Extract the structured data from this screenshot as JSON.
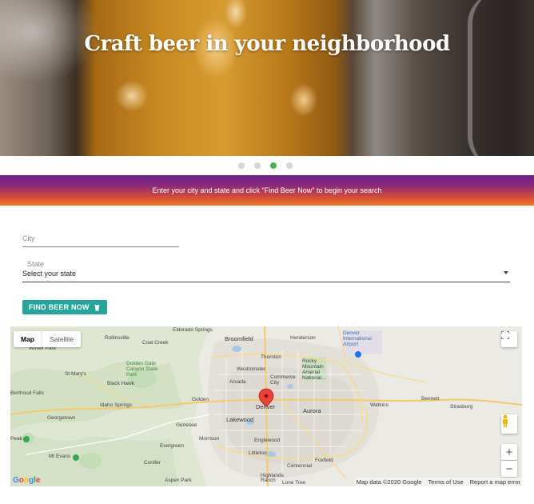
{
  "hero": {
    "title": "Craft beer in your neighborhood",
    "carousel_dots": 4,
    "active_dot": 3
  },
  "banner": {
    "text": "Enter your city and state and click \"Find Beer Now\" to begin your search"
  },
  "form": {
    "city_placeholder": "City",
    "state_label": "State",
    "state_value": "Select your state",
    "submit_label": "FIND BEER NOW"
  },
  "map": {
    "type_map": "Map",
    "type_satellite": "Satellite",
    "attribution": {
      "data": "Map data ©2020 Google",
      "terms": "Terms of Use",
      "report": "Report a map error"
    },
    "google_logo": "Google",
    "labels": {
      "eldorado": "Eldorado Springs",
      "henderson": "Henderson",
      "denver_airport": "Denver International Airport",
      "broomfield": "Broomfield",
      "rollinsville": "Rollinsville",
      "coal_creek": "Coal Creek",
      "winter_park": "Winter Park",
      "thornton": "Thornton",
      "golden_gate": "Golden Gate Canyon State Park",
      "westminster": "Westminster",
      "rocky_mountain": "Rocky Mountain Arsenal National...",
      "commerce_city": "Commerce City",
      "st_marys": "St Mary's",
      "black_hawk": "Black Hawk",
      "arvada": "Arvada",
      "berthoud": "Berthoud Falls",
      "idaho_springs": "Idaho Springs",
      "golden": "Golden",
      "denver": "Denver",
      "aurora": "Aurora",
      "watkins": "Watkins",
      "bennett": "Bennett",
      "strasburg": "Strasburg",
      "georgetown": "Georgetown",
      "lakewood": "Lakewood",
      "genesee": "Genesee",
      "peak": "Peak",
      "evergreen": "Evergreen",
      "morrison": "Morrison",
      "englewood": "Englewood",
      "mt_evans": "Mt Evans",
      "littleton": "Littleton",
      "centennial": "Centennial",
      "foxfield": "Foxfield",
      "conifer": "Conifer",
      "aspen_park": "Aspen Park",
      "highlands_ranch": "Highlands Ranch",
      "lone_tree": "Lone Tree"
    }
  }
}
